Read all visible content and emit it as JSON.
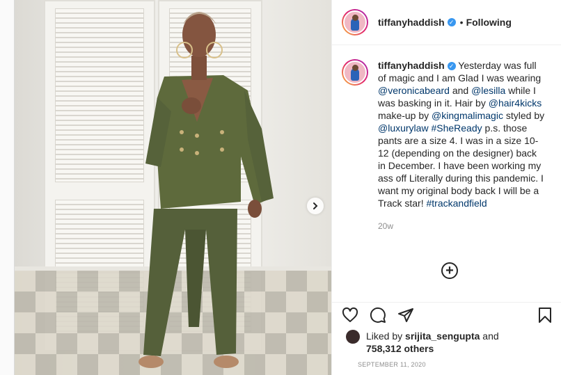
{
  "post": {
    "username": "tiffanyhaddish",
    "verified_mark": "✓",
    "separator": "•",
    "follow_status": "Following"
  },
  "caption": {
    "username": "tiffanyhaddish",
    "text_1": " Yesterday was full of magic and I am Glad I was wearing ",
    "mention_1": "@veronicabeard",
    "text_2": " and ",
    "mention_2": "@lesilla",
    "text_3": " while I was basking in it. Hair by ",
    "mention_3": "@hair4kicks",
    "text_4": " make-up by ",
    "mention_4": "@kingmalimagic",
    "text_5": " styled by ",
    "mention_5": "@luxurylaw",
    "text_6": " ",
    "hashtag_1": "#SheReady",
    "text_7": " p.s. those pants are a size 4. I was in a size 10-12 (depending on the designer) back in December. I have been working my ass off Literally during this pandemic. I want my original body back I will be a Track star! ",
    "hashtag_2": "#trackandfield",
    "age": "20w"
  },
  "add_comment_symbol": "+",
  "likes": {
    "prefix": "Liked by ",
    "user": "srijita_sengupta",
    "mid": " and",
    "count": "758,312 others"
  },
  "date": "SEPTEMBER 11, 2020",
  "icons": [
    "heart-icon",
    "comment-icon",
    "share-icon",
    "bookmark-icon",
    "chevron-right-icon",
    "plus-circle-icon"
  ],
  "colors": {
    "link": "#00376b",
    "verified": "#3897f0",
    "muted": "#8e8e8e",
    "suit": "#5e6a3c"
  }
}
